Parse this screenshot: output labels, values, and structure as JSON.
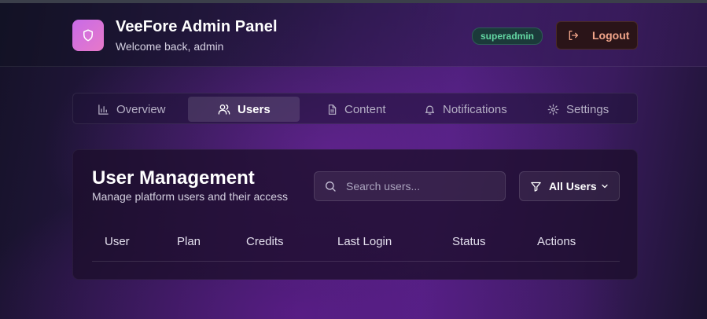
{
  "app": {
    "title": "VeeFore Admin Panel",
    "subtitle": "Welcome back, admin",
    "logo_icon": "shield-icon"
  },
  "header": {
    "role_badge": "superadmin",
    "logout_label": "Logout",
    "logout_icon": "logout-icon"
  },
  "tabs": [
    {
      "label": "Overview",
      "icon": "bar-chart-icon",
      "active": false
    },
    {
      "label": "Users",
      "icon": "users-icon",
      "active": true
    },
    {
      "label": "Content",
      "icon": "document-icon",
      "active": false
    },
    {
      "label": "Notifications",
      "icon": "bell-icon",
      "active": false
    },
    {
      "label": "Settings",
      "icon": "gear-icon",
      "active": false
    }
  ],
  "users_panel": {
    "title": "User Management",
    "subtitle": "Manage platform users and their access",
    "search": {
      "placeholder": "Search users...",
      "value": ""
    },
    "filter": {
      "label": "All Users",
      "icon": "filter-icon"
    },
    "columns": [
      "User",
      "Plan",
      "Credits",
      "Last Login",
      "Status",
      "Actions"
    ],
    "rows": []
  },
  "colors": {
    "logo_gradient_start": "#c86be8",
    "logo_gradient_end": "#e779c8",
    "badge_text": "#63d6a2",
    "logout_text": "#f2a58a",
    "background_accent": "#4a1f78"
  }
}
